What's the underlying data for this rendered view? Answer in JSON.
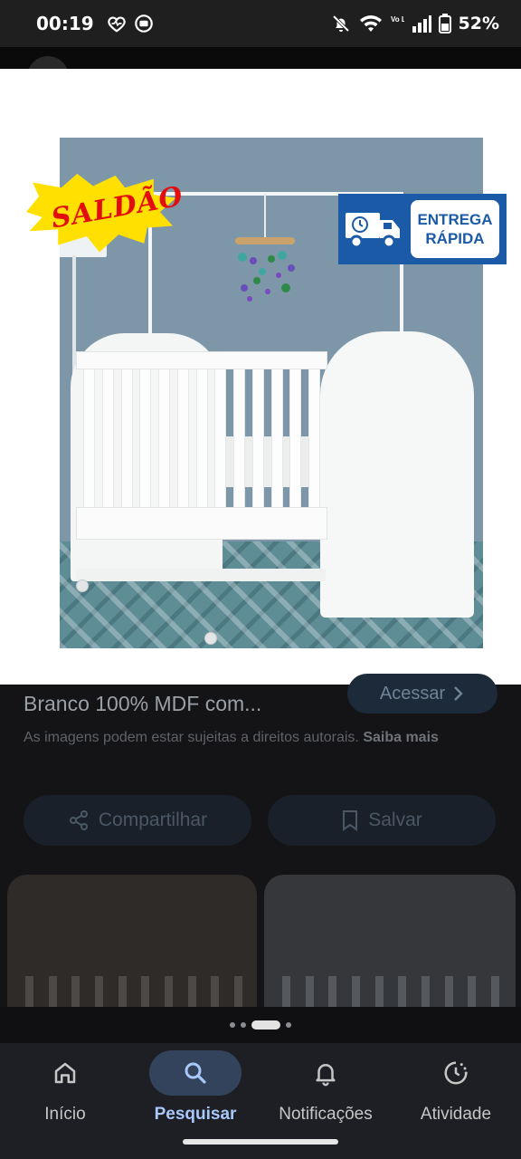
{
  "status_bar": {
    "time": "00:19",
    "battery": "52%",
    "icons": [
      "heart-monitor-icon",
      "media-icon",
      "bell-off-icon",
      "wifi-icon",
      "volte-icon",
      "signal-icon",
      "battery-icon"
    ],
    "volte_label": "Vo LTE"
  },
  "image": {
    "sale_badge": "SALDÃO",
    "delivery_badge": {
      "line1": "ENTREGA",
      "line2": "RÁPIDA"
    }
  },
  "details": {
    "title": "Branco 100% MDF com...",
    "visit_button": "Acessar",
    "copyright_text": "As imagens podem estar sujeitas a direitos autorais.",
    "learn_more": "Saiba mais",
    "share_button": "Compartilhar",
    "save_button": "Salvar"
  },
  "pager": {
    "count": 4,
    "active_index": 2
  },
  "bottom_nav": {
    "items": [
      {
        "label": "Início",
        "icon": "home-icon"
      },
      {
        "label": "Pesquisar",
        "icon": "search-icon",
        "active": true
      },
      {
        "label": "Notificações",
        "icon": "bell-icon"
      },
      {
        "label": "Atividade",
        "icon": "activity-icon"
      }
    ]
  },
  "colors": {
    "accent": "#a8c7fa",
    "active_pill": "#33435b",
    "sale_yellow": "#ffe000",
    "sale_red": "#e30d0d",
    "delivery_blue": "#1b5aa6"
  }
}
